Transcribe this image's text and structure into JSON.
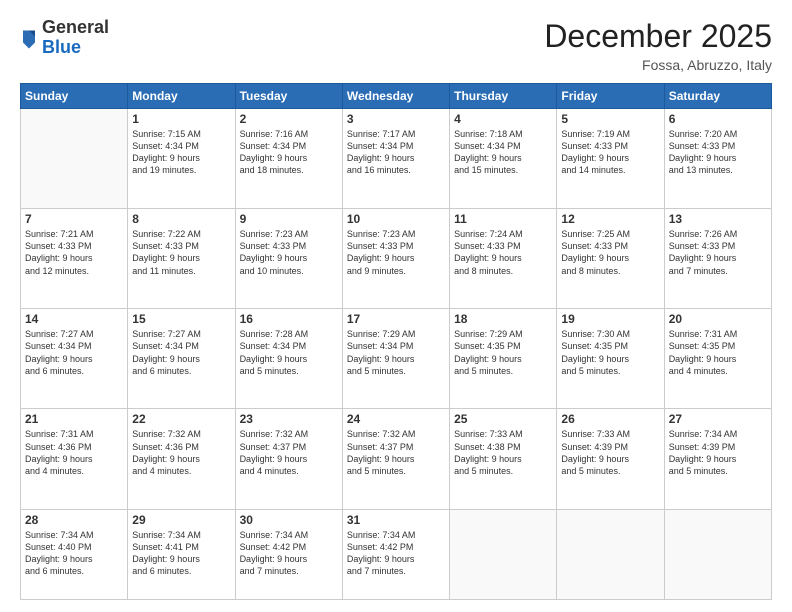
{
  "logo": {
    "general": "General",
    "blue": "Blue"
  },
  "header": {
    "month": "December 2025",
    "location": "Fossa, Abruzzo, Italy"
  },
  "weekdays": [
    "Sunday",
    "Monday",
    "Tuesday",
    "Wednesday",
    "Thursday",
    "Friday",
    "Saturday"
  ],
  "weeks": [
    [
      {
        "day": "",
        "lines": []
      },
      {
        "day": "1",
        "lines": [
          "Sunrise: 7:15 AM",
          "Sunset: 4:34 PM",
          "Daylight: 9 hours",
          "and 19 minutes."
        ]
      },
      {
        "day": "2",
        "lines": [
          "Sunrise: 7:16 AM",
          "Sunset: 4:34 PM",
          "Daylight: 9 hours",
          "and 18 minutes."
        ]
      },
      {
        "day": "3",
        "lines": [
          "Sunrise: 7:17 AM",
          "Sunset: 4:34 PM",
          "Daylight: 9 hours",
          "and 16 minutes."
        ]
      },
      {
        "day": "4",
        "lines": [
          "Sunrise: 7:18 AM",
          "Sunset: 4:34 PM",
          "Daylight: 9 hours",
          "and 15 minutes."
        ]
      },
      {
        "day": "5",
        "lines": [
          "Sunrise: 7:19 AM",
          "Sunset: 4:33 PM",
          "Daylight: 9 hours",
          "and 14 minutes."
        ]
      },
      {
        "day": "6",
        "lines": [
          "Sunrise: 7:20 AM",
          "Sunset: 4:33 PM",
          "Daylight: 9 hours",
          "and 13 minutes."
        ]
      }
    ],
    [
      {
        "day": "7",
        "lines": [
          "Sunrise: 7:21 AM",
          "Sunset: 4:33 PM",
          "Daylight: 9 hours",
          "and 12 minutes."
        ]
      },
      {
        "day": "8",
        "lines": [
          "Sunrise: 7:22 AM",
          "Sunset: 4:33 PM",
          "Daylight: 9 hours",
          "and 11 minutes."
        ]
      },
      {
        "day": "9",
        "lines": [
          "Sunrise: 7:23 AM",
          "Sunset: 4:33 PM",
          "Daylight: 9 hours",
          "and 10 minutes."
        ]
      },
      {
        "day": "10",
        "lines": [
          "Sunrise: 7:23 AM",
          "Sunset: 4:33 PM",
          "Daylight: 9 hours",
          "and 9 minutes."
        ]
      },
      {
        "day": "11",
        "lines": [
          "Sunrise: 7:24 AM",
          "Sunset: 4:33 PM",
          "Daylight: 9 hours",
          "and 8 minutes."
        ]
      },
      {
        "day": "12",
        "lines": [
          "Sunrise: 7:25 AM",
          "Sunset: 4:33 PM",
          "Daylight: 9 hours",
          "and 8 minutes."
        ]
      },
      {
        "day": "13",
        "lines": [
          "Sunrise: 7:26 AM",
          "Sunset: 4:33 PM",
          "Daylight: 9 hours",
          "and 7 minutes."
        ]
      }
    ],
    [
      {
        "day": "14",
        "lines": [
          "Sunrise: 7:27 AM",
          "Sunset: 4:34 PM",
          "Daylight: 9 hours",
          "and 6 minutes."
        ]
      },
      {
        "day": "15",
        "lines": [
          "Sunrise: 7:27 AM",
          "Sunset: 4:34 PM",
          "Daylight: 9 hours",
          "and 6 minutes."
        ]
      },
      {
        "day": "16",
        "lines": [
          "Sunrise: 7:28 AM",
          "Sunset: 4:34 PM",
          "Daylight: 9 hours",
          "and 5 minutes."
        ]
      },
      {
        "day": "17",
        "lines": [
          "Sunrise: 7:29 AM",
          "Sunset: 4:34 PM",
          "Daylight: 9 hours",
          "and 5 minutes."
        ]
      },
      {
        "day": "18",
        "lines": [
          "Sunrise: 7:29 AM",
          "Sunset: 4:35 PM",
          "Daylight: 9 hours",
          "and 5 minutes."
        ]
      },
      {
        "day": "19",
        "lines": [
          "Sunrise: 7:30 AM",
          "Sunset: 4:35 PM",
          "Daylight: 9 hours",
          "and 5 minutes."
        ]
      },
      {
        "day": "20",
        "lines": [
          "Sunrise: 7:31 AM",
          "Sunset: 4:35 PM",
          "Daylight: 9 hours",
          "and 4 minutes."
        ]
      }
    ],
    [
      {
        "day": "21",
        "lines": [
          "Sunrise: 7:31 AM",
          "Sunset: 4:36 PM",
          "Daylight: 9 hours",
          "and 4 minutes."
        ]
      },
      {
        "day": "22",
        "lines": [
          "Sunrise: 7:32 AM",
          "Sunset: 4:36 PM",
          "Daylight: 9 hours",
          "and 4 minutes."
        ]
      },
      {
        "day": "23",
        "lines": [
          "Sunrise: 7:32 AM",
          "Sunset: 4:37 PM",
          "Daylight: 9 hours",
          "and 4 minutes."
        ]
      },
      {
        "day": "24",
        "lines": [
          "Sunrise: 7:32 AM",
          "Sunset: 4:37 PM",
          "Daylight: 9 hours",
          "and 5 minutes."
        ]
      },
      {
        "day": "25",
        "lines": [
          "Sunrise: 7:33 AM",
          "Sunset: 4:38 PM",
          "Daylight: 9 hours",
          "and 5 minutes."
        ]
      },
      {
        "day": "26",
        "lines": [
          "Sunrise: 7:33 AM",
          "Sunset: 4:39 PM",
          "Daylight: 9 hours",
          "and 5 minutes."
        ]
      },
      {
        "day": "27",
        "lines": [
          "Sunrise: 7:34 AM",
          "Sunset: 4:39 PM",
          "Daylight: 9 hours",
          "and 5 minutes."
        ]
      }
    ],
    [
      {
        "day": "28",
        "lines": [
          "Sunrise: 7:34 AM",
          "Sunset: 4:40 PM",
          "Daylight: 9 hours",
          "and 6 minutes."
        ]
      },
      {
        "day": "29",
        "lines": [
          "Sunrise: 7:34 AM",
          "Sunset: 4:41 PM",
          "Daylight: 9 hours",
          "and 6 minutes."
        ]
      },
      {
        "day": "30",
        "lines": [
          "Sunrise: 7:34 AM",
          "Sunset: 4:42 PM",
          "Daylight: 9 hours",
          "and 7 minutes."
        ]
      },
      {
        "day": "31",
        "lines": [
          "Sunrise: 7:34 AM",
          "Sunset: 4:42 PM",
          "Daylight: 9 hours",
          "and 7 minutes."
        ]
      },
      {
        "day": "",
        "lines": []
      },
      {
        "day": "",
        "lines": []
      },
      {
        "day": "",
        "lines": []
      }
    ]
  ]
}
